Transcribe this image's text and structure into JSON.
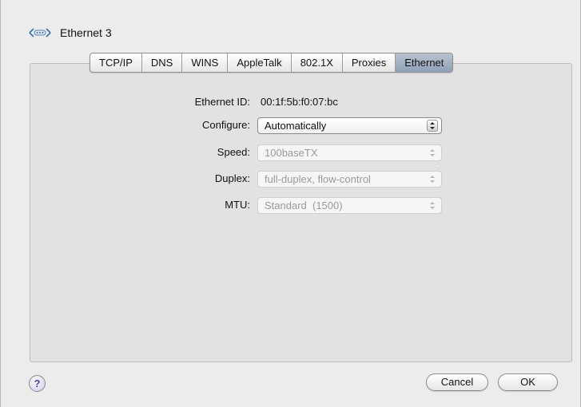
{
  "header": {
    "title": "Ethernet 3",
    "icon": "network-ethernet-icon"
  },
  "tabs": [
    {
      "label": "TCP/IP"
    },
    {
      "label": "DNS"
    },
    {
      "label": "WINS"
    },
    {
      "label": "AppleTalk"
    },
    {
      "label": "802.1X"
    },
    {
      "label": "Proxies"
    },
    {
      "label": "Ethernet",
      "selected": true
    }
  ],
  "fields": {
    "ethernet_id": {
      "label": "Ethernet ID:",
      "value": "00:1f:5b:f0:07:bc"
    },
    "configure": {
      "label": "Configure:",
      "value": "Automatically"
    },
    "speed": {
      "label": "Speed:",
      "value": "100baseTX"
    },
    "duplex": {
      "label": "Duplex:",
      "value": "full-duplex, flow-control"
    },
    "mtu": {
      "label": "MTU:",
      "value": "Standard  (1500)"
    }
  },
  "footer": {
    "help_label": "?",
    "cancel_label": "Cancel",
    "ok_label": "OK"
  },
  "colors": {
    "selected_tab": "#9fadbf",
    "help_accent": "#5a3aa0"
  }
}
